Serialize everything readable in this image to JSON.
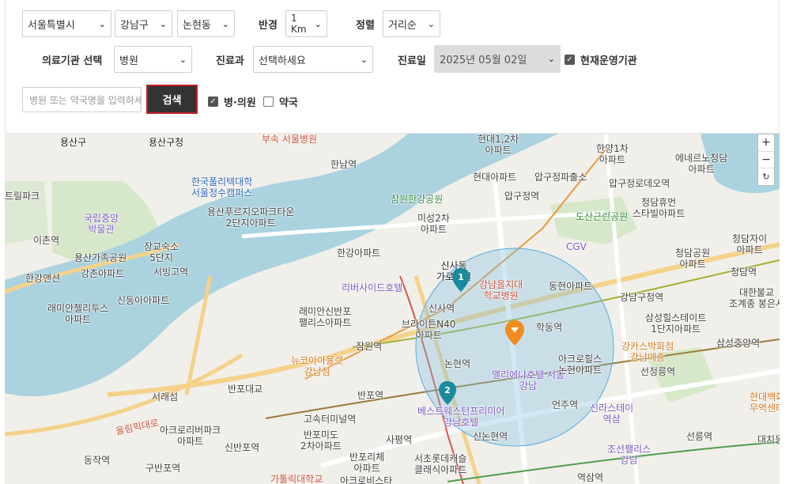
{
  "filters": {
    "city": "서울특별시",
    "district": "강남구",
    "dong": "논현동",
    "radius_label": "반경",
    "radius": "1 Km",
    "sort_label": "정렬",
    "sort": "거리순",
    "facility_label": "의료기관 선택",
    "facility": "병원",
    "dept_label": "진료과",
    "dept": "선택하세요",
    "date_label": "진료일",
    "date": "2025년 05월 02일",
    "open_now": "현재운영기관",
    "search_placeholder": "병원 또는 약국명을 입력하세요",
    "search_button": "검색",
    "hospital_check": "병·의원",
    "pharmacy_check": "약국"
  },
  "map": {
    "zoom_in": "+",
    "zoom_out": "−",
    "reset": "↻",
    "markers": [
      "1",
      "2"
    ],
    "colors": {
      "water": "#aad3df",
      "park": "#cfe5c4",
      "radius": "#7fc1e3",
      "marker_teal": "#1b8a9c",
      "marker_orange": "#f28a1e"
    },
    "labels": [
      {
        "t": "용산구",
        "c": "dark"
      },
      {
        "t": "용산구청",
        "c": "dark"
      },
      {
        "t": "부속 서울병원",
        "c": "red"
      },
      {
        "t": "한남역",
        "c": ""
      },
      {
        "t": "현대1,2차\n아파트",
        "c": ""
      },
      {
        "t": "한양1차\n아파트",
        "c": ""
      },
      {
        "t": "에네르노청담\n아파트",
        "c": ""
      },
      {
        "t": "한국폴리텍대학\n서울정수캠퍼스",
        "c": "blue"
      },
      {
        "t": "현대아파트",
        "c": ""
      },
      {
        "t": "압구정파출소",
        "c": ""
      },
      {
        "t": "압구정로데오역",
        "c": ""
      },
      {
        "t": "트릴파크",
        "c": ""
      },
      {
        "t": "잠원한강공원",
        "c": "green"
      },
      {
        "t": "압구정역",
        "c": ""
      },
      {
        "t": "청담휴먼\n스타빌아파트",
        "c": ""
      },
      {
        "t": "국립중앙\n박물관",
        "c": "purple"
      },
      {
        "t": "용산푸르지오파크타운\n2단지아파트",
        "c": ""
      },
      {
        "t": "미성2차\n아파트",
        "c": ""
      },
      {
        "t": "도산근린공원",
        "c": "green"
      },
      {
        "t": "이촌역",
        "c": ""
      },
      {
        "t": "장교숙소\n5단지",
        "c": ""
      },
      {
        "t": "CGV",
        "c": "purple"
      },
      {
        "t": "청담자이\n아파트",
        "c": ""
      },
      {
        "t": "용산가족공원",
        "c": ""
      },
      {
        "t": "한강아파트",
        "c": ""
      },
      {
        "t": "신사동\n가로수길",
        "c": "dark"
      },
      {
        "t": "청담공원\n아파트",
        "c": ""
      },
      {
        "t": "한강맨션",
        "c": ""
      },
      {
        "t": "강촌아파트",
        "c": ""
      },
      {
        "t": "서빙고역",
        "c": ""
      },
      {
        "t": "강남을지대\n학교병원",
        "c": "red"
      },
      {
        "t": "청담역",
        "c": ""
      },
      {
        "t": "리버사이드호텔",
        "c": "purple"
      },
      {
        "t": "동현아파트",
        "c": ""
      },
      {
        "t": "강남구청역",
        "c": ""
      },
      {
        "t": "대한불교\n조계종 봉은사",
        "c": ""
      },
      {
        "t": "신동아아파트",
        "c": ""
      },
      {
        "t": "래미안첼리투스\n아파트",
        "c": ""
      },
      {
        "t": "래미안신반포\n팰리스아파트",
        "c": ""
      },
      {
        "t": "신사역",
        "c": ""
      },
      {
        "t": "브라이튼N40\n아파트",
        "c": ""
      },
      {
        "t": "학동역",
        "c": ""
      },
      {
        "t": "삼성힐스테이트\n1단지아파트",
        "c": ""
      },
      {
        "t": "잠원역",
        "c": ""
      },
      {
        "t": "강카스박화점\n강남메종",
        "c": "orange"
      },
      {
        "t": "삼성중앙역",
        "c": ""
      },
      {
        "t": "뉴코아아울렛\n강남점",
        "c": "orange"
      },
      {
        "t": "논현역",
        "c": ""
      },
      {
        "t": "엘리에나호텔 서울\n강남",
        "c": "purple"
      },
      {
        "t": "아크로힐스\n논현아파트",
        "c": ""
      },
      {
        "t": "선정릉역",
        "c": ""
      },
      {
        "t": "반포대교",
        "c": ""
      },
      {
        "t": "반포역",
        "c": ""
      },
      {
        "t": "서래섬",
        "c": ""
      },
      {
        "t": "베스트웨스턴프리미어\n강남호텔",
        "c": "purple"
      },
      {
        "t": "언주역",
        "c": ""
      },
      {
        "t": "신라스테이\n역삼",
        "c": "purple"
      },
      {
        "t": "고속터미널역",
        "c": ""
      },
      {
        "t": "아크로리버파크\n아파트",
        "c": ""
      },
      {
        "t": "반포미도\n2차아파트",
        "c": ""
      },
      {
        "t": "사평역",
        "c": ""
      },
      {
        "t": "신논현역",
        "c": ""
      },
      {
        "t": "선릉역",
        "c": ""
      },
      {
        "t": "동작역",
        "c": ""
      },
      {
        "t": "신반포역",
        "c": ""
      },
      {
        "t": "반포리체\n아파트",
        "c": ""
      },
      {
        "t": "서초롯데캐슬\n클래식아파트",
        "c": ""
      },
      {
        "t": "조선팰리스\n강남",
        "c": "purple"
      },
      {
        "t": "구반포역",
        "c": ""
      },
      {
        "t": "가톨릭대학교",
        "c": "red"
      },
      {
        "t": "아크로비스타",
        "c": ""
      },
      {
        "t": "역삼역",
        "c": ""
      },
      {
        "t": "올림픽대로",
        "c": "red"
      },
      {
        "t": "현대백화\n무역센터",
        "c": "orange"
      },
      {
        "t": "대치동",
        "c": ""
      }
    ]
  }
}
